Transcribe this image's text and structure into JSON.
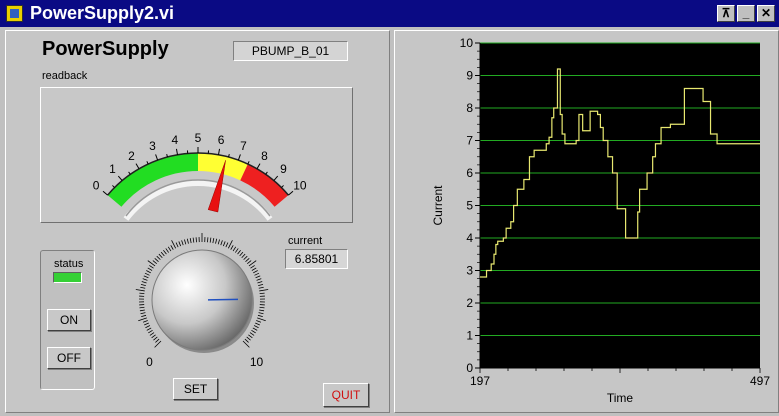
{
  "window": {
    "title": "PowerSupply2.vi",
    "buttons": [
      "⊼",
      "_",
      "✕"
    ]
  },
  "front_panel": {
    "title": "PowerSupply",
    "device_name": "PBUMP_B_01",
    "readback_label": "readback",
    "gauge": {
      "min": 0,
      "max": 10,
      "value": 6.4,
      "ticks": [
        "0",
        "1",
        "2",
        "3",
        "4",
        "5",
        "6",
        "7",
        "8",
        "9",
        "10"
      ],
      "zones": [
        {
          "from": 0,
          "to": 5,
          "color": "#22dd22"
        },
        {
          "from": 5,
          "to": 7.5,
          "color": "#ffff33"
        },
        {
          "from": 7.5,
          "to": 10,
          "color": "#ee2020"
        }
      ]
    },
    "status_label": "status",
    "on_label": "ON",
    "off_label": "OFF",
    "knob": {
      "min_label": "0",
      "max_label": "10",
      "value": 8.3
    },
    "set_label": "SET",
    "current_label": "current",
    "current_value": "6.85801",
    "quit_label": "QUIT"
  },
  "chart_data": {
    "type": "line",
    "xlabel": "Time",
    "ylabel": "Current",
    "xlim": [
      197,
      497
    ],
    "ylim": [
      0,
      10
    ],
    "x_tick_labels": [
      "197",
      "497"
    ],
    "y_ticks": [
      0,
      1,
      2,
      3,
      4,
      5,
      6,
      7,
      8,
      9,
      10
    ],
    "grid": true,
    "colors": {
      "background": "#000000",
      "grid": "#22aa22",
      "line": "#e8e870"
    },
    "x": [
      197,
      201,
      204,
      209,
      212,
      214,
      216,
      222,
      225,
      230,
      233,
      237,
      244,
      250,
      255,
      268,
      271,
      274,
      276,
      280,
      283,
      285,
      288,
      296,
      300,
      303,
      307,
      315,
      323,
      326,
      329,
      334,
      339,
      344,
      353,
      356,
      362,
      366,
      368,
      376,
      382,
      385,
      391,
      401,
      416,
      426,
      436,
      444,
      451,
      458,
      471,
      487,
      497
    ],
    "y": [
      2.8,
      2.8,
      3.0,
      3.2,
      3.5,
      3.8,
      3.9,
      4.0,
      4.3,
      4.5,
      5.0,
      5.5,
      5.8,
      6.5,
      6.7,
      6.9,
      7.1,
      7.7,
      8.0,
      9.2,
      7.8,
      7.2,
      6.9,
      6.9,
      7.0,
      7.8,
      7.3,
      7.9,
      7.8,
      7.4,
      7.0,
      6.5,
      6.0,
      4.9,
      4.0,
      4.0,
      4.0,
      4.8,
      5.5,
      6.0,
      6.5,
      6.9,
      7.4,
      7.5,
      8.6,
      8.6,
      8.2,
      7.2,
      6.9,
      6.9,
      6.9,
      6.9,
      6.9
    ]
  }
}
